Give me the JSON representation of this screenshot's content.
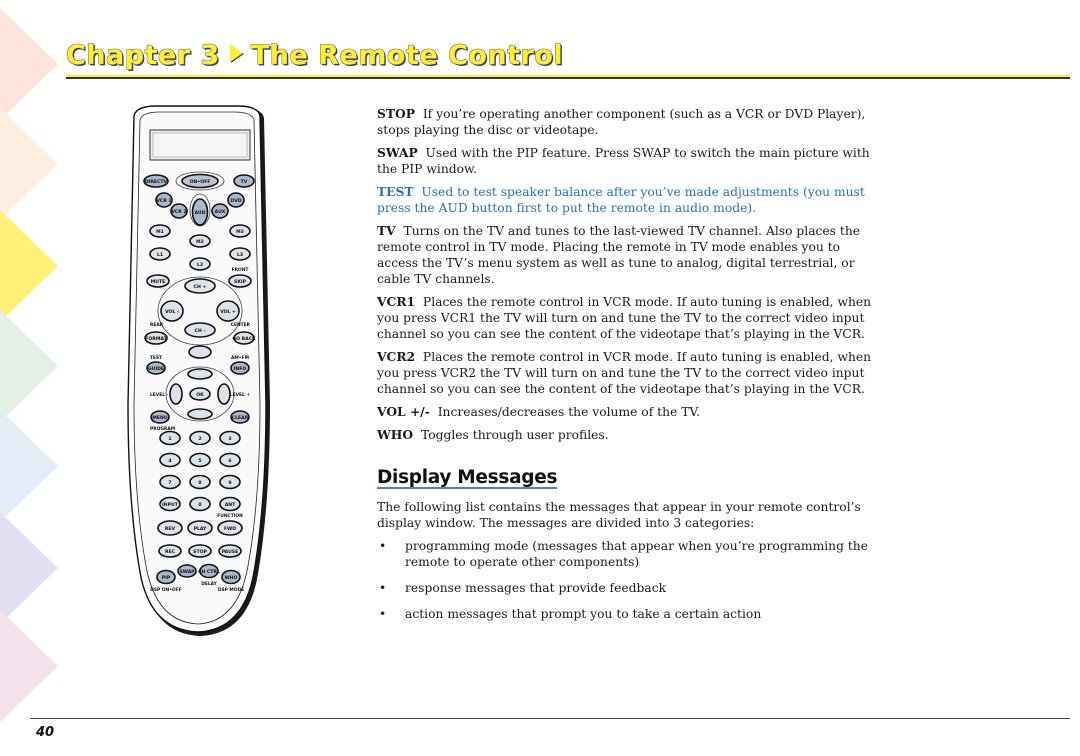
{
  "header": {
    "chapter_label": "Chapter 3",
    "separator_icon": "triangle-right-icon",
    "section_title": "The Remote Control",
    "title_color": "#ffee33"
  },
  "decor": {
    "chevron_colors": [
      "#fde3dc",
      "#fdeee2",
      "#fff176",
      "#e3f0e6",
      "#e4ecf8",
      "#e2e0f0",
      "#f3e2ec"
    ]
  },
  "remote": {
    "buttons": {
      "directv": "DIRECTV",
      "on_off": "ON•OFF",
      "tv": "TV",
      "vcr1": "VCR 1",
      "vcr2": "VCR 2",
      "aud": "AUD",
      "aux": "AUX",
      "dvd": "DVD",
      "m1": "M1",
      "m2": "M2",
      "m3": "M3",
      "l1": "L1",
      "l2": "L2",
      "l3": "L3",
      "mute": "MUTE",
      "skip": "SKIP",
      "front": "FRONT",
      "ch_up": "CH +",
      "ch_down": "CH -",
      "vol_down": "VOL -",
      "vol_up": "VOL +",
      "rear": "REAR",
      "format": "FORMAT",
      "center": "CENTER",
      "go_back": "GO BACK",
      "test": "TEST",
      "guide": "GUIDE",
      "am_fm": "AM•FM",
      "info": "INFO",
      "level_down": "LEVEL -",
      "ok": "OK",
      "level_up": "LEVEL +",
      "menu": "MENU",
      "clear": "CLEAR",
      "program": "PROGRAM",
      "digits": [
        "1",
        "2",
        "3",
        "4",
        "5",
        "6",
        "7",
        "8",
        "9"
      ],
      "input": "INPUT",
      "zero": "0",
      "ant": "ANT",
      "function": "FUNCTION",
      "rev": "REV",
      "play": "PLAY",
      "fwd": "FWD",
      "rec": "REC",
      "stop": "STOP",
      "pause": "PAUSE",
      "pip": "PIP",
      "swap": "SWAP",
      "ch_ctrl": "CH CTRL",
      "who": "WHO",
      "dsp_onoff": "DSP ON•OFF",
      "delay": "DELAY",
      "dsp_mode": "DSP MODE"
    }
  },
  "definitions": [
    {
      "term": "STOP",
      "text": "If you’re operating another component (such as a VCR or DVD Player), stops playing the disc or videotape.",
      "highlight": false
    },
    {
      "term": "SWAP",
      "text": "Used with the PIP feature. Press SWAP to switch the main picture with the PIP window.",
      "highlight": false
    },
    {
      "term": "TEST",
      "text": "Used to test speaker balance after you’ve made adjustments (you must press the AUD button first to put the remote in audio mode).",
      "highlight": true
    },
    {
      "term": "TV",
      "text": "Turns on the TV and tunes to the last-viewed TV channel. Also places the remote control in TV mode. Placing the remote in TV mode enables you to access the TV’s menu system as well as tune to analog, digital terrestrial, or cable TV channels.",
      "highlight": false
    },
    {
      "term": "VCR1",
      "text": "Places the remote control in VCR mode. If auto tuning is enabled, when you press VCR1 the TV will turn on and tune the TV to the correct video input channel so you can see the content of the videotape that’s playing in the VCR.",
      "highlight": false
    },
    {
      "term": "VCR2",
      "text": "Places the remote control in VCR mode. If auto tuning is enabled, when you press VCR2 the TV will turn on and tune the TV to the correct video input channel so you can see the content of the videotape that’s playing in the VCR.",
      "highlight": false
    },
    {
      "term": "VOL +/-",
      "text": "Increases/decreases the volume of the TV.",
      "highlight": false
    },
    {
      "term": "WHO",
      "text": "Toggles through user profiles.",
      "highlight": false
    }
  ],
  "display_messages": {
    "heading": "Display Messages",
    "intro": "The following list contains the messages that appear in your remote control’s display window. The messages are divided into 3 categories:",
    "bullet_glyph": "•",
    "items": [
      "programming mode (messages that appear when you’re programming the remote to operate other components)",
      "response messages that provide feedback",
      "action messages that prompt you to take a certain action"
    ]
  },
  "footer": {
    "page_number": "40"
  },
  "colors": {
    "highlight_text": "#2a6fb8",
    "heading_rule": "#5b7fa6"
  }
}
